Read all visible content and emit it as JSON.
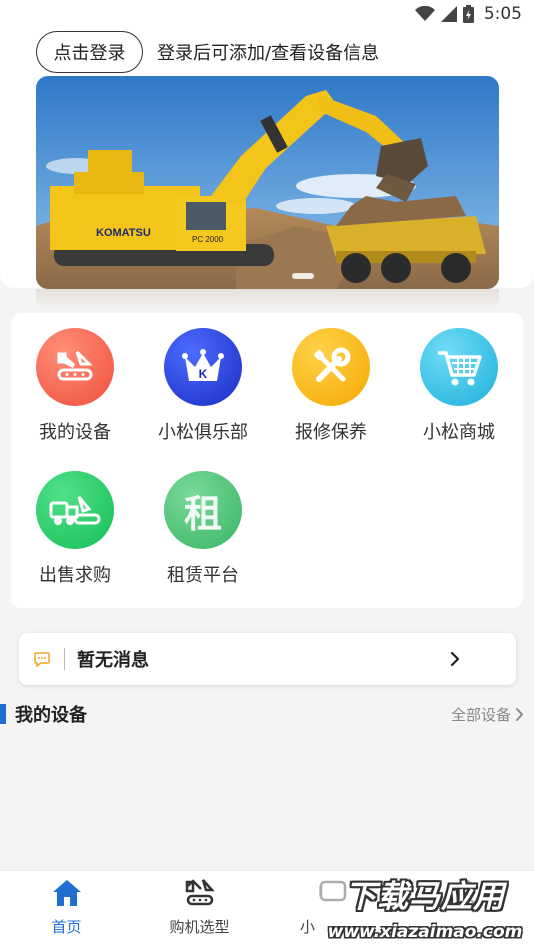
{
  "status_bar": {
    "time": "5:05",
    "icons": [
      "wifi-icon",
      "cell-signal-icon",
      "battery-icon"
    ]
  },
  "header": {
    "login_button": "点击登录",
    "login_hint": "登录后可添加/查看设备信息"
  },
  "banner": {
    "image": "komatsu-excavator-photo",
    "machine_brand": "KOMATSU",
    "machine_model": "PC 2000",
    "slide_count": 2
  },
  "grid": {
    "items": [
      {
        "label": "我的设备",
        "icon": "excavator-icon",
        "color": "#f46a55"
      },
      {
        "label": "小松俱乐部",
        "icon": "crown-icon",
        "color": "#2440d8"
      },
      {
        "label": "报修保养",
        "icon": "tools-icon",
        "color": "#fbb10f"
      },
      {
        "label": "小松商城",
        "icon": "cart-icon",
        "color": "#35c4e8"
      },
      {
        "label": "出售求购",
        "icon": "truck-icon",
        "color": "#20cc66"
      },
      {
        "label": "租赁平台",
        "icon": "rent-icon",
        "icon_text": "租",
        "color": "#4ec77a"
      }
    ]
  },
  "message": {
    "text": "暂无消息",
    "icon": "chat-bubble-icon",
    "accent": "#f5a623"
  },
  "section": {
    "title": "我的设备",
    "more": "全部设备",
    "accent": "#1e6fd0"
  },
  "tabs": [
    {
      "label": "首页",
      "icon": "home-icon",
      "active": true
    },
    {
      "label": "购机选型",
      "icon": "excavator-icon",
      "active": false
    },
    {
      "label": "小",
      "icon": "chat-icon",
      "active": false
    },
    {
      "label": "",
      "icon": "user-icon",
      "active": false
    }
  ],
  "watermark": {
    "title": "下载马应用",
    "url": "www.xiazaimao.com"
  }
}
